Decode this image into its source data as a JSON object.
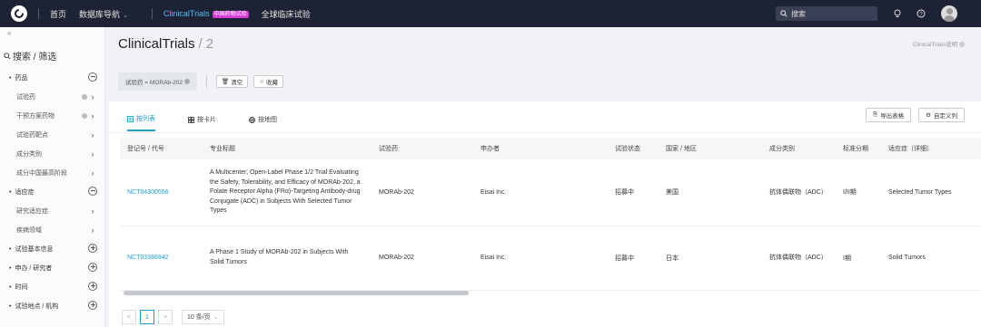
{
  "topbar": {
    "home": "首页",
    "db_nav": "数据库导航",
    "clinicaltrials": "ClinicalTrials",
    "badge": "中国药物试验",
    "global_trials": "全球临床试验",
    "search_placeholder": "搜索"
  },
  "sidebar": {
    "collapse": "«",
    "title": "搜索 / 筛选",
    "rows": [
      {
        "label": "药品",
        "type": "group",
        "ctl": "minus"
      },
      {
        "label": "试验药",
        "type": "sub",
        "ctl": "chevron",
        "info": true
      },
      {
        "label": "干预方案药物",
        "type": "sub",
        "ctl": "chevron",
        "info": true
      },
      {
        "label": "试验药靶点",
        "type": "sub",
        "ctl": "chevron"
      },
      {
        "label": "成分类别",
        "type": "sub",
        "ctl": "chevron"
      },
      {
        "label": "成分中国最高阶段",
        "type": "sub",
        "ctl": "chevron"
      },
      {
        "label": "适应症",
        "type": "group",
        "ctl": "minus"
      },
      {
        "label": "研究适应症",
        "type": "sub",
        "ctl": "chevron"
      },
      {
        "label": "疾病领域",
        "type": "sub",
        "ctl": "chevron"
      },
      {
        "label": "试验基本信息",
        "type": "group",
        "ctl": "plus"
      },
      {
        "label": "申办 / 研究者",
        "type": "group",
        "ctl": "plus"
      },
      {
        "label": "时间",
        "type": "group",
        "ctl": "plus"
      },
      {
        "label": "试验地点 / 机构",
        "type": "group",
        "ctl": "plus"
      }
    ]
  },
  "main": {
    "title": "ClinicalTrials",
    "count": "/ 2",
    "help": "ClinicalTrials说明",
    "filter_chip": "试验药 = MORAb-202",
    "clear": "清空",
    "favorite": "收藏",
    "tabs": [
      "按列表",
      "按卡片",
      "按地图"
    ],
    "export": "导出表格",
    "custom_cols": "自定义列",
    "columns": [
      "登记号 / 代号",
      "专业标题",
      "试验药",
      "申办者",
      "试验状态",
      "国家 / 地区",
      "成分类别",
      "标准分期",
      "适应症（详细）"
    ],
    "rows": [
      {
        "code": "NCT04300556",
        "title": "A Multicenter, Open-Label Phase 1/2 Trial Evaluating the Safety, Tolerability, and Efficacy of MORAb-202, a Folate Receptor Alpha (FRα)-Targeting Antibody-drug Conjugate (ADC) in Subjects With Selected Tumor Types",
        "drug": "MORAb-202",
        "sponsor": "Eisai Inc.",
        "status": "招募中",
        "country": "美国",
        "category": "抗体偶联物（ADC）",
        "phase": "I/II期",
        "indication": "Selected Tumor Types"
      },
      {
        "code": "NCT03386942",
        "title": "A Phase 1 Study of MORAb-202 in Subjects With Solid Tumors",
        "drug": "MORAb-202",
        "sponsor": "Eisai Inc.",
        "status": "招募中",
        "country": "日本",
        "category": "抗体偶联物（ADC）",
        "phase": "I期",
        "indication": "Solid Tumors"
      }
    ],
    "pager": {
      "prev": "<",
      "page": "1",
      "next": ">",
      "size": "10 条/页"
    }
  }
}
